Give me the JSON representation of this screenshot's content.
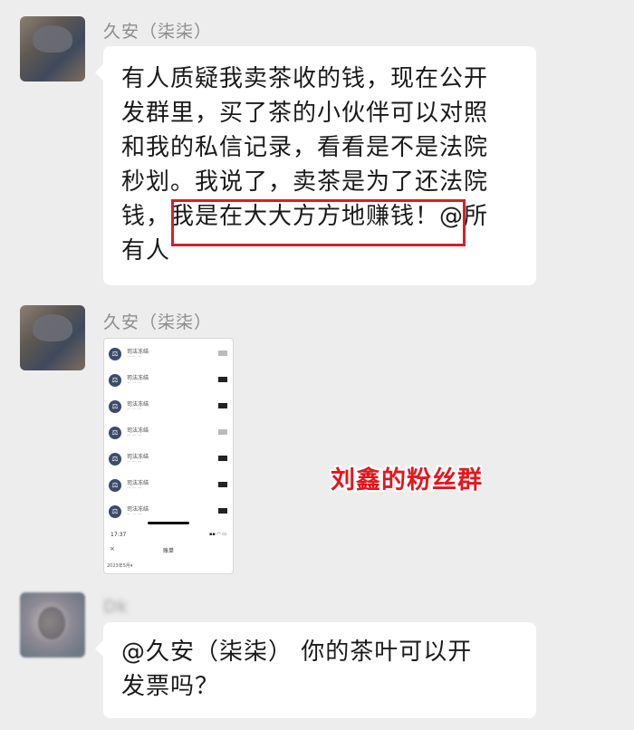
{
  "messages": [
    {
      "sender": "久安（柒柒）",
      "lines": [
        "有人质疑我卖茶收的钱，现在公开",
        "发群里，买了茶的小伙伴可以对照",
        "和我的私信记录，看看是不是法院",
        "秒划。我说了，卖茶是为了还法院",
        "钱，我是在大大方方地赚钱！@所",
        "有人"
      ]
    },
    {
      "sender": "久安（柒柒）",
      "screenshot": {
        "rows": [
          {
            "name": "司法冻结",
            "value_shade": "light"
          },
          {
            "name": "司法冻结",
            "value_shade": "dark"
          },
          {
            "name": "司法冻结",
            "value_shade": "dark"
          },
          {
            "name": "司法冻结",
            "value_shade": "light"
          },
          {
            "name": "司法冻结",
            "value_shade": "dark"
          },
          {
            "name": "司法冻结",
            "value_shade": "dark"
          },
          {
            "name": "司法冻结",
            "value_shade": "dark"
          }
        ],
        "time": "17:37",
        "title": "账单",
        "close": "×",
        "date": "2023年5月▾"
      }
    },
    {
      "sender": "Dk",
      "lines": [
        "@久安（柒柒） 你的茶叶可以开",
        "发票吗？"
      ]
    }
  ],
  "overlay_caption": "刘鑫的粉丝群",
  "colors": {
    "background": "#ededed",
    "bubble": "#ffffff",
    "highlight_box": "#d5202a",
    "caption": "#e8141c"
  }
}
